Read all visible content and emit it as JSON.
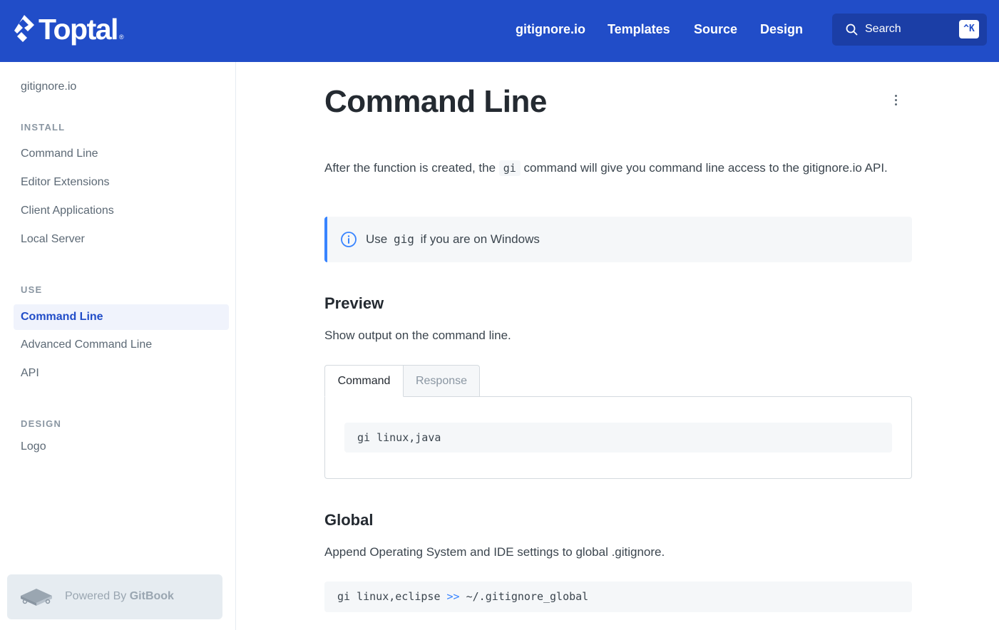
{
  "header": {
    "logo_text": "Toptal",
    "logo_reg": "®",
    "nav": [
      "gitignore.io",
      "Templates",
      "Source",
      "Design"
    ],
    "search_label": "Search",
    "search_shortcut": "^K",
    "bg_color": "#214dc8"
  },
  "sidebar": {
    "top_item": "gitignore.io",
    "sections": [
      {
        "title": "INSTALL",
        "items": [
          "Command Line",
          "Editor Extensions",
          "Client Applications",
          "Local Server"
        ]
      },
      {
        "title": "USE",
        "items": [
          "Command Line",
          "Advanced Command Line",
          "API"
        ]
      },
      {
        "title": "DESIGN",
        "items": [
          "Logo"
        ]
      }
    ],
    "active_item": "Command Line",
    "powered_prefix": "Powered By ",
    "powered_brand": "GitBook"
  },
  "content": {
    "title": "Command Line",
    "intro_before": "After the function is created, the ",
    "intro_code": "gi",
    "intro_after": " command will give you command line access to the gitignore.io API.",
    "hint_before": "Use ",
    "hint_code": "gig",
    "hint_after": " if you are on Windows",
    "preview_heading": "Preview",
    "preview_text": "Show output on the command line.",
    "tabs": [
      "Command",
      "Response"
    ],
    "preview_code": "gi linux,java",
    "global_heading": "Global",
    "global_text": "Append Operating System and IDE settings to global .gitignore.",
    "global_code_start": "gi linux,eclipse ",
    "global_code_op": ">>",
    "global_code_end": " ~/.gitignore_global"
  }
}
